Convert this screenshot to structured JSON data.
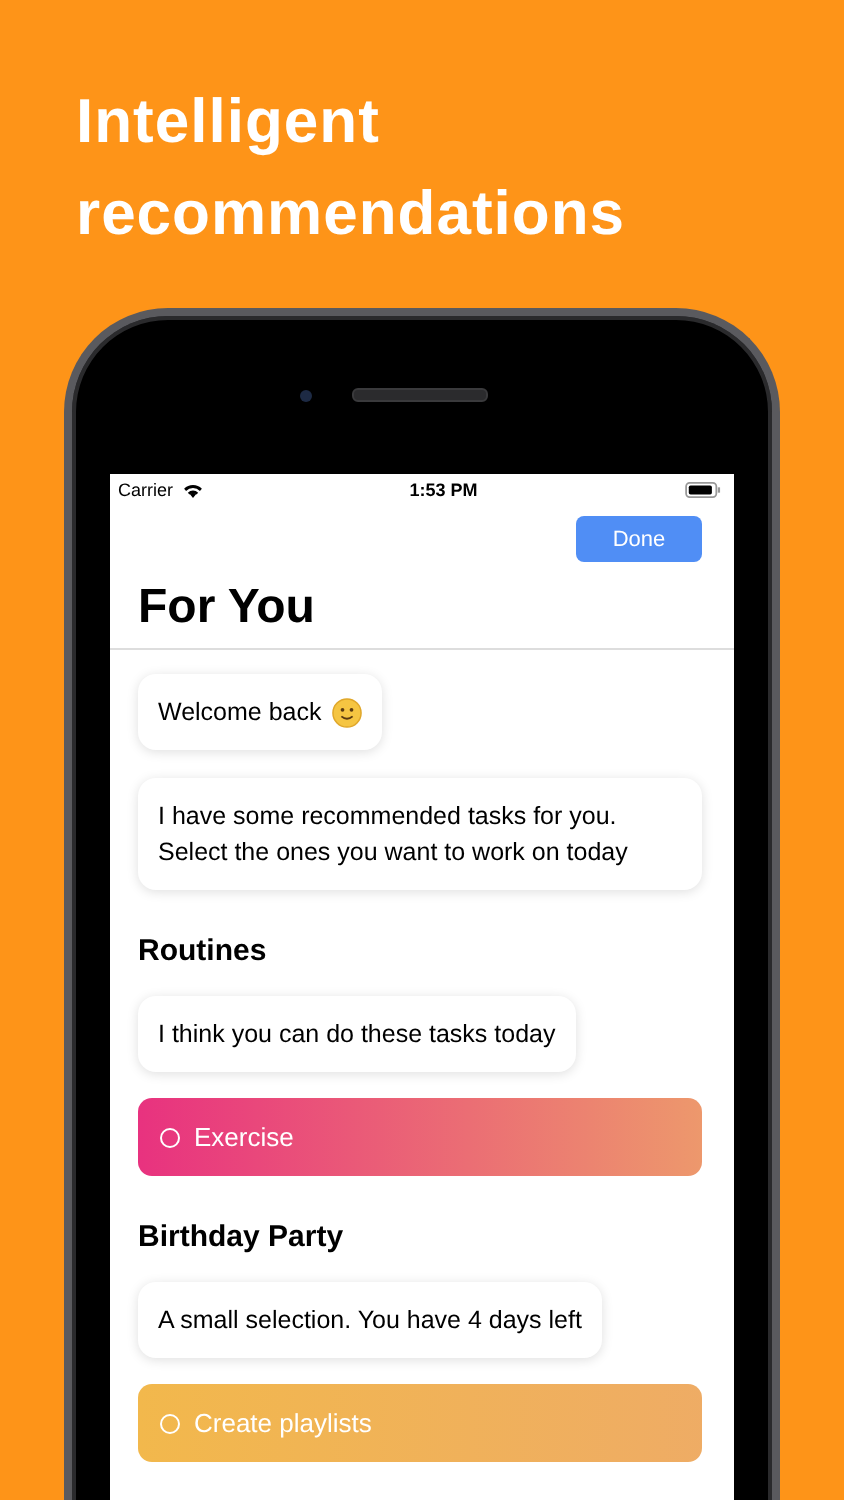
{
  "headline": "Intelligent recommendations",
  "status_bar": {
    "carrier": "Carrier",
    "time": "1:53 PM"
  },
  "nav": {
    "button": "Done",
    "title": "For You"
  },
  "feed": [
    {
      "kind": "bubble",
      "text": "Welcome back",
      "emoji": true
    },
    {
      "kind": "bubble",
      "text": "I have some recommended tasks for you. Select the ones you want to work on today",
      "emoji": false
    },
    {
      "kind": "heading",
      "text": "Routines"
    },
    {
      "kind": "bubble",
      "text": "I think you can do these tasks today",
      "emoji": false
    },
    {
      "kind": "task",
      "text": "Exercise",
      "checked": false,
      "color": "#e8327f"
    },
    {
      "kind": "heading",
      "text": "Birthday Party"
    },
    {
      "kind": "bubble",
      "text": "A small selection. You have 4 days left",
      "emoji": false
    },
    {
      "kind": "task",
      "text": "Create playlists",
      "checked": false,
      "color": "#f2b84c"
    }
  ]
}
